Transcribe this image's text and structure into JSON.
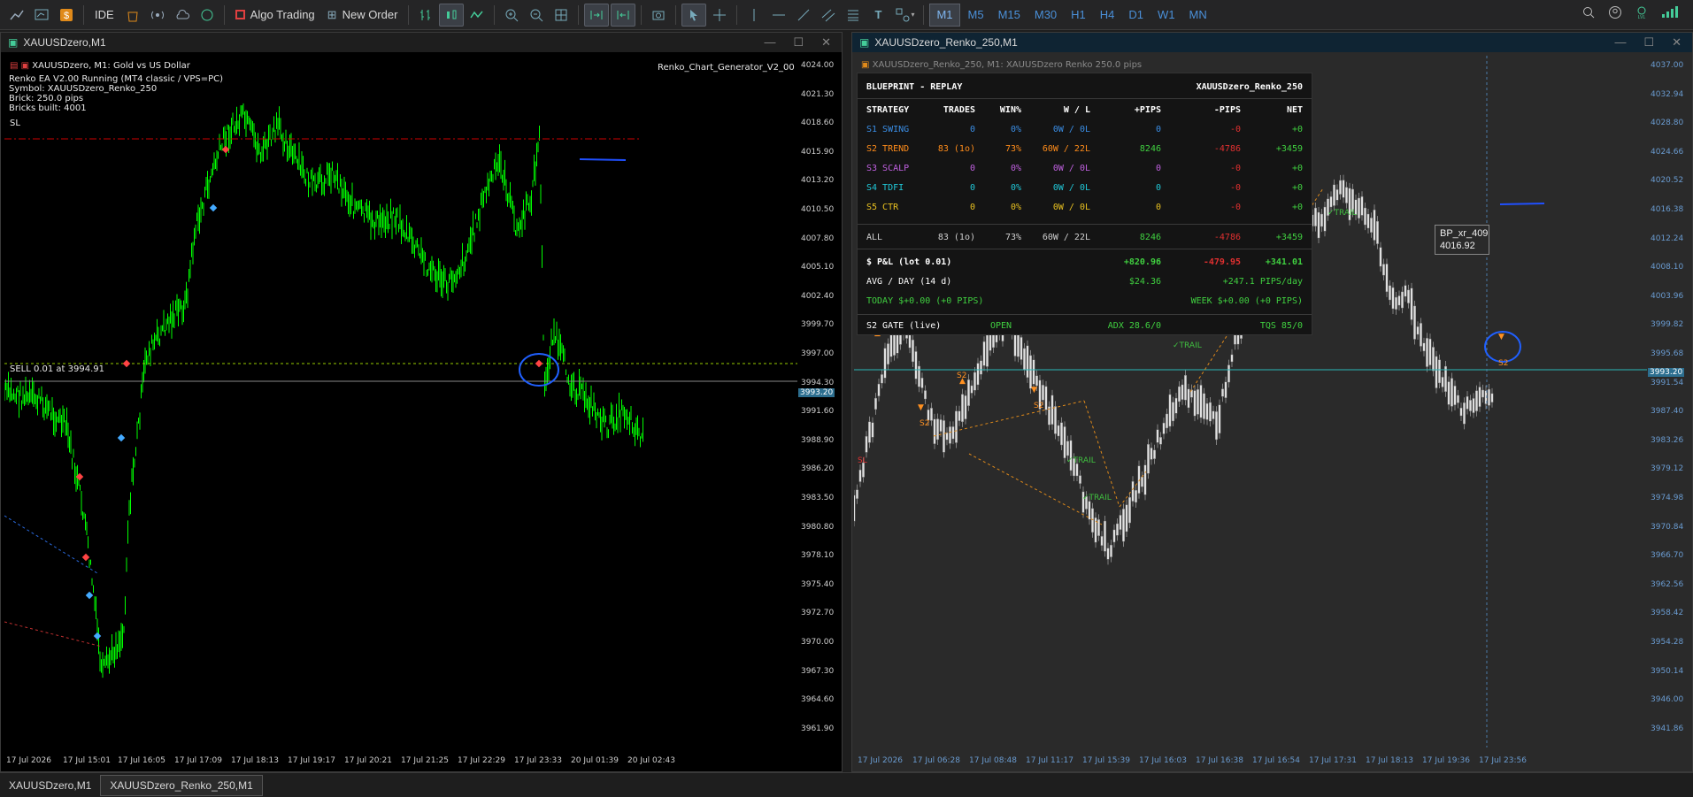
{
  "toolbar": {
    "algo": "Algo Trading",
    "neworder": "New Order",
    "ide": "IDE",
    "timeframes": [
      "M1",
      "M5",
      "M15",
      "M30",
      "H1",
      "H4",
      "D1",
      "W1",
      "MN"
    ],
    "active_tf": "M1"
  },
  "left": {
    "title": "XAUUSDzero,M1",
    "symbol_line": "XAUUSDzero, M1:  Gold vs US Dollar",
    "indicator": "Renko_Chart_Generator_V2_00",
    "info": [
      "Renko EA V2.00 Running (MT4 classic / VPS=PC)",
      "Symbol: XAUUSDzero_Renko_250",
      "Brick: 250.0 pips",
      "Bricks built: 4001"
    ],
    "sl_label": "SL",
    "sell_label": "SELL 0.01 at 3994.91",
    "price_badge": "3993.20",
    "yticks": [
      "4024.00",
      "4021.30",
      "4018.60",
      "4015.90",
      "4013.20",
      "4010.50",
      "4007.80",
      "4005.10",
      "4002.40",
      "3999.70",
      "3997.00",
      "3994.30",
      "3991.60",
      "3988.90",
      "3986.20",
      "3983.50",
      "3980.80",
      "3978.10",
      "3975.40",
      "3972.70",
      "3970.00",
      "3967.30",
      "3964.60",
      "3961.90"
    ],
    "xticks": [
      "17 Jul 2026",
      "17 Jul 15:01",
      "17 Jul 16:05",
      "17 Jul 17:09",
      "17 Jul 18:13",
      "17 Jul 19:17",
      "17 Jul 20:21",
      "17 Jul 21:25",
      "17 Jul 22:29",
      "17 Jul 23:33",
      "20 Jul 01:39",
      "20 Jul 02:43"
    ]
  },
  "right": {
    "title": "XAUUSDzero_Renko_250,M1",
    "symbol_line": "XAUUSDzero_Renko_250, M1:  XAUUSDzero Renko 250.0 pips",
    "price_badge": "3993.20",
    "yticks": [
      "4037.00",
      "4032.94",
      "4028.80",
      "4024.66",
      "4020.52",
      "4016.38",
      "4012.24",
      "4008.10",
      "4003.96",
      "3999.82",
      "3995.68",
      "3991.54",
      "3987.40",
      "3983.26",
      "3979.12",
      "3974.98",
      "3970.84",
      "3966.70",
      "3962.56",
      "3958.42",
      "3954.28",
      "3950.14",
      "3946.00",
      "3941.86"
    ],
    "xticks": [
      "17 Jul 2026",
      "17 Jul 06:28",
      "17 Jul 08:48",
      "17 Jul 11:17",
      "17 Jul 15:39",
      "17 Jul 16:03",
      "17 Jul 16:38",
      "17 Jul 16:54",
      "17 Jul 17:31",
      "17 Jul 18:13",
      "17 Jul 19:36",
      "17 Jul 23:56"
    ],
    "tooltip": [
      "BP_xr_409",
      "4016.92"
    ],
    "marks": {
      "s2": "S2",
      "trail": "TRAIL",
      "sl": "SL"
    }
  },
  "panel": {
    "title": "BLUEPRINT - REPLAY",
    "symbol": "XAUUSDzero_Renko_250",
    "headers": [
      "STRATEGY",
      "TRADES",
      "WIN%",
      "W / L",
      "+PIPS",
      "-PIPS",
      "NET"
    ],
    "rows": [
      {
        "c": "#3a8ee6",
        "v": [
          "S1 SWING",
          "0",
          "0%",
          "0W / 0L",
          "0",
          "-0",
          "+0"
        ]
      },
      {
        "c": "#ff8c1a",
        "v": [
          "S2 TREND",
          "83 (1o)",
          "73%",
          "60W / 22L",
          "8246",
          "-4786",
          "+3459"
        ]
      },
      {
        "c": "#c060e0",
        "v": [
          "S3 SCALP",
          "0",
          "0%",
          "0W / 0L",
          "0",
          "-0",
          "+0"
        ]
      },
      {
        "c": "#20c8d8",
        "v": [
          "S4 TDFI",
          "0",
          "0%",
          "0W / 0L",
          "0",
          "-0",
          "+0"
        ]
      },
      {
        "c": "#e8c020",
        "v": [
          "S5 CTR",
          "0",
          "0%",
          "0W / 0L",
          "0",
          "-0",
          "+0"
        ]
      }
    ],
    "all": [
      "ALL",
      "83 (1o)",
      "73%",
      "60W / 22L",
      "8246",
      "-4786",
      "+3459"
    ],
    "pnl": [
      "$ P&L (lot 0.01)",
      "+820.96",
      "-479.95",
      "+341.01"
    ],
    "avg": [
      "AVG / DAY (14 d)",
      "$24.36",
      "+247.1 PIPS/day"
    ],
    "today": "TODAY  $+0.00 (+0 PIPS)",
    "week": "WEEK  $+0.00 (+0 PIPS)",
    "gate": [
      "S2 GATE (live)",
      "OPEN",
      "ADX 28.6/0",
      "TQS 85/0"
    ]
  },
  "tabs": [
    "XAUUSDzero,M1",
    "XAUUSDzero_Renko_250,M1"
  ]
}
